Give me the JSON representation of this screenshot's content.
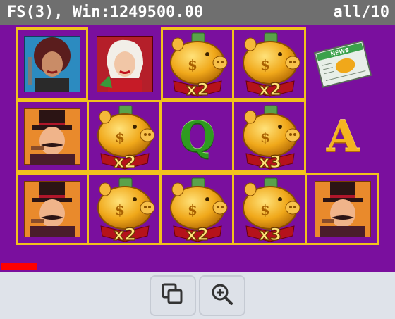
{
  "header": {
    "status_text": "FS(3), Win:1249500.00",
    "lines_text": "all/10"
  },
  "board": {
    "rows": 3,
    "cols": 5,
    "grid": [
      [
        {
          "symbol": "woman-curly-hair",
          "multiplier": ""
        },
        {
          "symbol": "woman-blonde",
          "multiplier": ""
        },
        {
          "symbol": "gold-piggy-bank",
          "multiplier": "x2"
        },
        {
          "symbol": "gold-piggy-bank",
          "multiplier": "x2"
        },
        {
          "symbol": "newspaper",
          "multiplier": ""
        }
      ],
      [
        {
          "symbol": "man-top-hat",
          "multiplier": ""
        },
        {
          "symbol": "gold-piggy-bank",
          "multiplier": "x2"
        },
        {
          "symbol": "letter-q",
          "letter": "Q",
          "multiplier": ""
        },
        {
          "symbol": "gold-piggy-bank",
          "multiplier": "x3"
        },
        {
          "symbol": "letter-a",
          "letter": "A",
          "multiplier": ""
        }
      ],
      [
        {
          "symbol": "man-top-hat",
          "multiplier": ""
        },
        {
          "symbol": "gold-piggy-bank",
          "multiplier": "x2"
        },
        {
          "symbol": "gold-piggy-bank",
          "multiplier": "x2"
        },
        {
          "symbol": "gold-piggy-bank",
          "multiplier": "x3"
        },
        {
          "symbol": "man-top-hat",
          "multiplier": ""
        }
      ]
    ],
    "highlighted_cells": [
      [
        0,
        0
      ],
      [
        0,
        2
      ],
      [
        0,
        3
      ],
      [
        1,
        0
      ],
      [
        1,
        1
      ],
      [
        1,
        2
      ],
      [
        1,
        3
      ],
      [
        2,
        0
      ],
      [
        2,
        1
      ],
      [
        2,
        2
      ],
      [
        2,
        3
      ],
      [
        2,
        4
      ]
    ]
  },
  "colors": {
    "board_bg": "#7a0f9e",
    "frame": "#f2c21c",
    "header_bg": "#6f6f6f",
    "progress": "#ff0000"
  },
  "toolbar": {
    "buttons": [
      {
        "icon": "copy-icon"
      },
      {
        "icon": "zoom-in-icon"
      }
    ]
  }
}
